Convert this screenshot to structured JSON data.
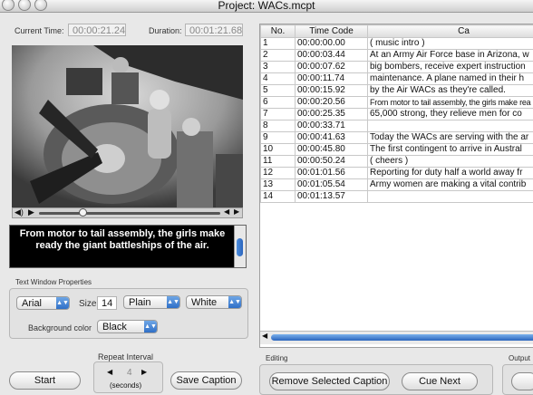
{
  "window": {
    "title": "Project: WACs.mcpt"
  },
  "time": {
    "current_label": "Current Time:",
    "current_value": "00:00:21.24",
    "duration_label": "Duration:",
    "duration_value": "00:01:21.68"
  },
  "player": {
    "progress": 0.24
  },
  "caption_editor": {
    "text": "From motor to tail assembly, the girls make ready the giant battleships of the air."
  },
  "text_props": {
    "title": "Text Window Properties",
    "font": "Arial",
    "size_label": "Size:",
    "size": "14",
    "style": "Plain",
    "color": "White",
    "bg_label": "Background color",
    "bg_color": "Black"
  },
  "repeat": {
    "label": "Repeat Interval",
    "value": "4",
    "unit": "(seconds)"
  },
  "buttons": {
    "start": "Start",
    "save_caption": "Save Caption",
    "remove": "Remove Selected Caption",
    "cue_next": "Cue Next"
  },
  "sections": {
    "editing": "Editing",
    "output": "Output"
  },
  "table": {
    "headers": [
      "No.",
      "Time Code",
      "Ca"
    ],
    "rows": [
      [
        "1",
        "00:00:00.00",
        "( music intro )"
      ],
      [
        "2",
        "00:00:03.44",
        "At an Army Air Force base in Arizona, w"
      ],
      [
        "3",
        "00:00:07.62",
        "big bombers, receive expert instruction"
      ],
      [
        "4",
        "00:00:11.74",
        "maintenance. A plane named in their h"
      ],
      [
        "5",
        "00:00:15.92",
        "by the Air WACs as they're called."
      ],
      [
        "6",
        "00:00:20.56",
        "From motor to tail assembly, the girls make rea"
      ],
      [
        "7",
        "00:00:25.35",
        "65,000 strong, they relieve men for co"
      ],
      [
        "8",
        "00:00:33.71",
        ""
      ],
      [
        "9",
        "00:00:41.63",
        "Today the WACs are serving with the ar"
      ],
      [
        "10",
        "00:00:45.80",
        "The first contingent to arrive in Austral"
      ],
      [
        "11",
        "00:00:50.24",
        "( cheers )"
      ],
      [
        "12",
        "00:01:01.56",
        "Reporting for duty half a world away fr"
      ],
      [
        "13",
        "00:01:05.54",
        "Army women are making a vital contrib"
      ],
      [
        "14",
        "00:01:13.57",
        ""
      ]
    ]
  },
  "colors": {
    "accent": "#2f6fc7",
    "caption_bg": "#000000"
  }
}
